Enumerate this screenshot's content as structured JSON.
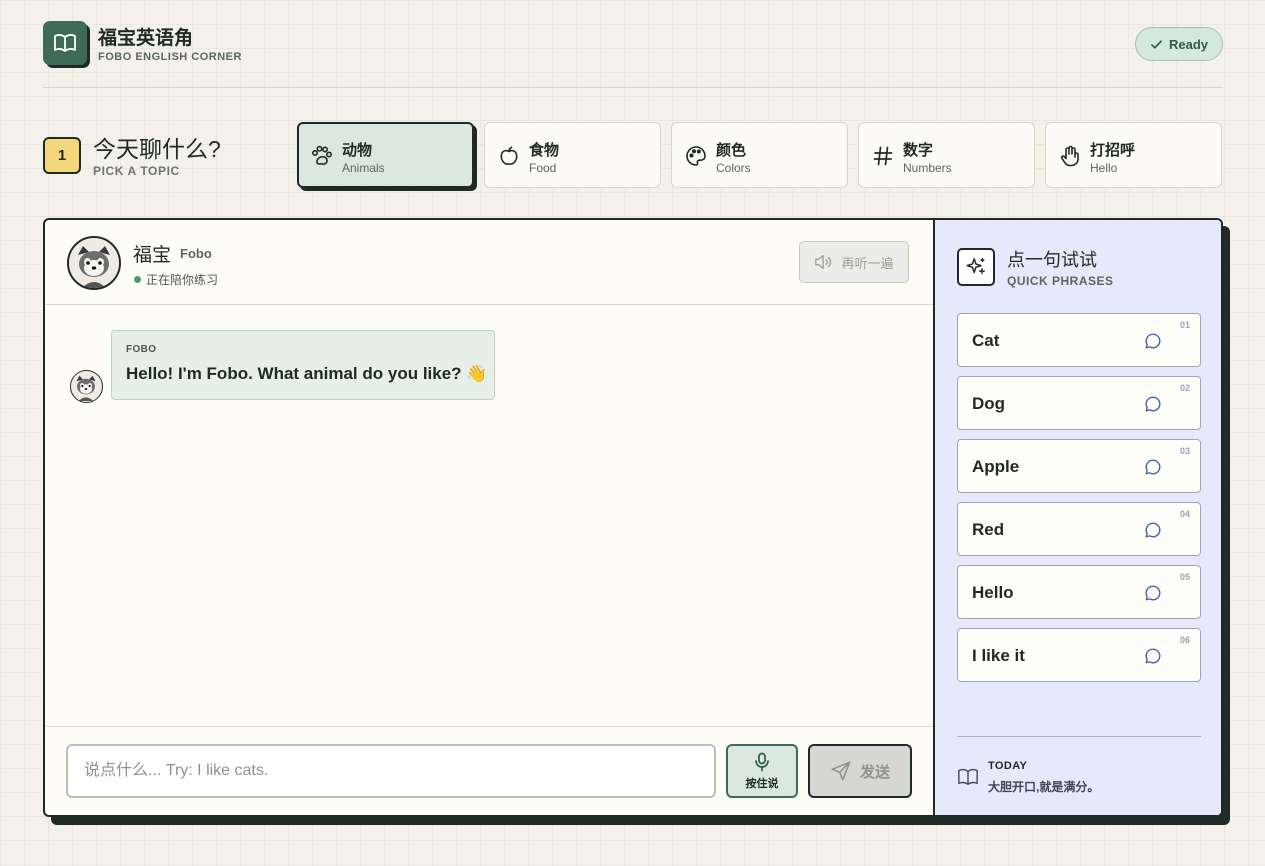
{
  "app": {
    "title": "福宝英语角",
    "subtitle": "FOBO ENGLISH CORNER",
    "status": "Ready"
  },
  "topics": {
    "step": "1",
    "title": "今天聊什么?",
    "subtitle": "PICK A TOPIC",
    "items": [
      {
        "cn": "动物",
        "en": "Animals",
        "icon": "paw-icon",
        "selected": true
      },
      {
        "cn": "食物",
        "en": "Food",
        "icon": "apple-icon",
        "selected": false
      },
      {
        "cn": "颜色",
        "en": "Colors",
        "icon": "palette-icon",
        "selected": false
      },
      {
        "cn": "数字",
        "en": "Numbers",
        "icon": "hash-icon",
        "selected": false
      },
      {
        "cn": "打招呼",
        "en": "Hello",
        "icon": "hand-icon",
        "selected": false
      }
    ]
  },
  "chat": {
    "name": "福宝",
    "name_en": "Fobo",
    "status": "正在陪你练习",
    "replay_label": "再听一遍",
    "messages": [
      {
        "sender": "FOBO",
        "text": "Hello! I'm Fobo. What animal do you like? 👋"
      }
    ],
    "input_placeholder": "说点什么... Try: I like cats.",
    "input_value": "",
    "mic_label": "按住说",
    "send_label": "发送"
  },
  "sidebar": {
    "title": "点一句试试",
    "subtitle": "QUICK PHRASES",
    "phrases": [
      {
        "num": "01",
        "text": "Cat"
      },
      {
        "num": "02",
        "text": "Dog"
      },
      {
        "num": "03",
        "text": "Apple"
      },
      {
        "num": "04",
        "text": "Red"
      },
      {
        "num": "05",
        "text": "Hello"
      },
      {
        "num": "06",
        "text": "I like it"
      }
    ],
    "footer_label": "TODAY",
    "footer_text": "大胆开口,就是满分。"
  },
  "colors": {
    "brand_green": "#3d6b57",
    "ink": "#1f2a26",
    "selected_topic_bg": "#dbe8df",
    "sidebar_bg": "#e5e9fb",
    "step_badge": "#f3d77a",
    "online": "#4f9a6c"
  }
}
